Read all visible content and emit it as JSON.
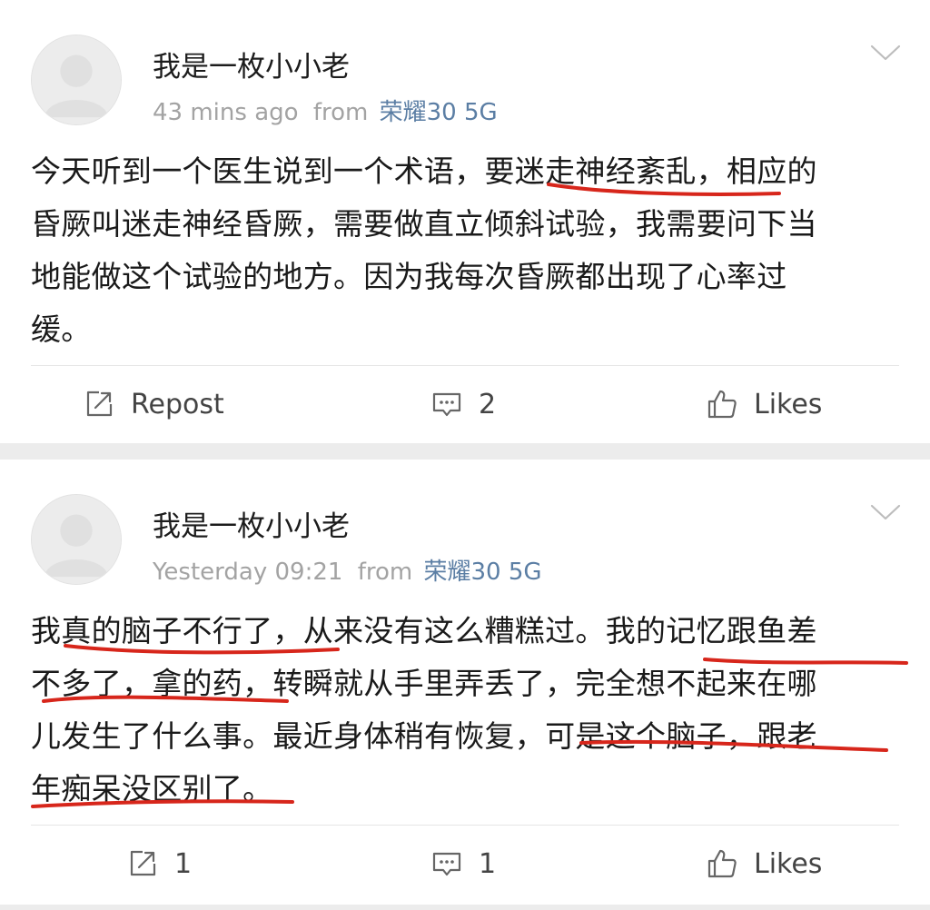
{
  "posts": [
    {
      "username": "我是一枚小小老",
      "time": "43 mins ago",
      "from_label": "from",
      "device": "荣耀30 5G",
      "lines": [
        "今天听到一个医生说到一个术语，要迷走神经紊乱，相应的",
        "昏厥叫迷走神经昏厥，需要做直立倾斜试验，我需要问下当",
        "地能做这个试验的地方。因为我每次昏厥都出现了心率过",
        "缓。"
      ],
      "actions": {
        "repost": "Repost",
        "comments": "2",
        "likes": "Likes"
      }
    },
    {
      "username": "我是一枚小小老",
      "time": "Yesterday 09:21",
      "from_label": "from",
      "device": "荣耀30 5G",
      "lines": [
        "我真的脑子不行了，从来没有这么糟糕过。我的记忆跟鱼差",
        "不多了，拿的药，转瞬就从手里弄丢了，完全想不起来在哪",
        "儿发生了什么事。最近身体稍有恢复，可是这个脑子，跟老",
        "年痴呆没区别了。"
      ],
      "actions": {
        "repost": "1",
        "comments": "1",
        "likes": "Likes"
      }
    }
  ],
  "colors": {
    "page_bg": "#ececec",
    "card_bg": "#ffffff",
    "meta_gray": "#a3a3a3",
    "device_blue": "#5b7ea4",
    "annotation_red": "#d7261b"
  },
  "icons": [
    "avatar-placeholder",
    "chevron-down-icon",
    "repost-icon",
    "comment-icon",
    "like-icon"
  ]
}
